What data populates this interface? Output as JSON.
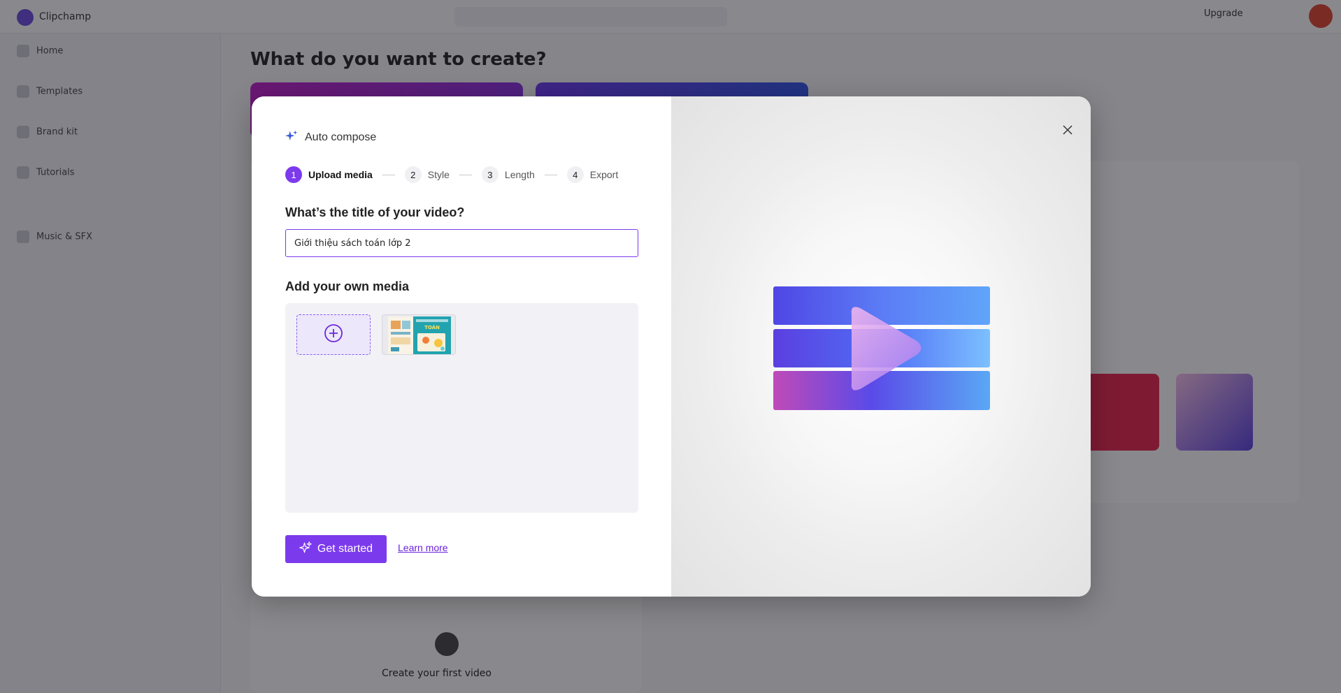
{
  "background": {
    "app_name": "Clipchamp",
    "upgrade_label": "Upgrade",
    "sidebar": [
      "Home",
      "Templates",
      "Brand kit",
      "Tutorials",
      "Music & SFX"
    ],
    "heading": "What do you want to create?",
    "bottom_card_label": "Create your first video"
  },
  "modal": {
    "title": "Auto compose",
    "steps": [
      {
        "num": "1",
        "label": "Upload media",
        "active": true
      },
      {
        "num": "2",
        "label": "Style",
        "active": false
      },
      {
        "num": "3",
        "label": "Length",
        "active": false
      },
      {
        "num": "4",
        "label": "Export",
        "active": false
      }
    ],
    "question": "What’s the title of your video?",
    "title_value": "Giới thiệu sách toán lớp 2",
    "media_heading": "Add your own media",
    "media_thumb_text": "TOÁN",
    "get_started_label": "Get started",
    "learn_more_label": "Learn more"
  },
  "icons": {
    "sparkle": "sparkle-icon",
    "add": "add-circle-icon",
    "close": "close-icon",
    "hero": "video-play-illustration"
  },
  "colors": {
    "accent": "#7c3aed",
    "link": "#6b21d8"
  }
}
